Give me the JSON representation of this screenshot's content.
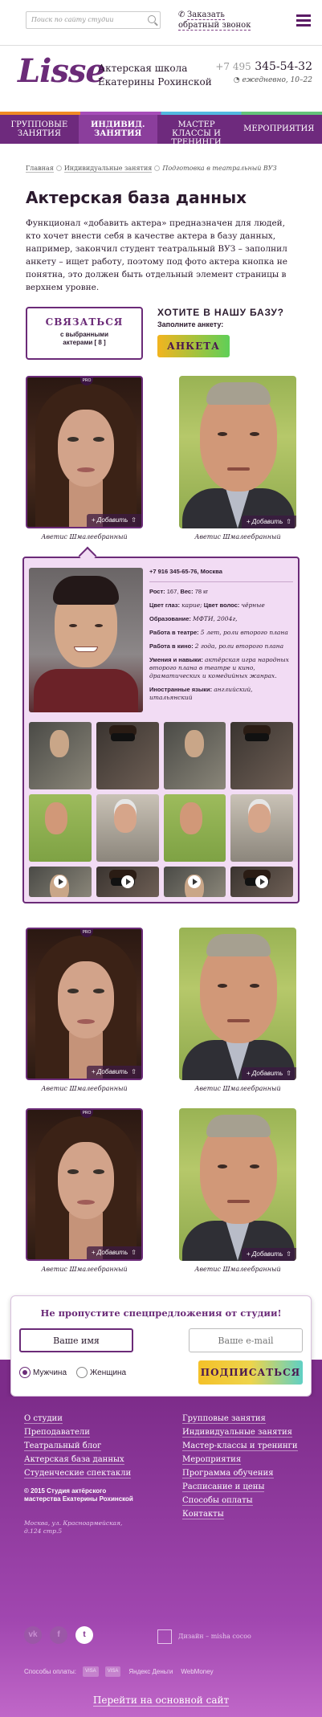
{
  "header": {
    "search_placeholder": "Поиск по сайту студии",
    "callback_line1": "Заказать",
    "callback_line2": "обратный звонок"
  },
  "brand": {
    "logo": "Lisse",
    "school_line1": "Актерская школа",
    "school_line2": "Екатерины Рохинской",
    "phone_prefix": "+7 495",
    "phone_number": "345-54-32",
    "hours": "ежедневно, 10–22"
  },
  "nav": {
    "items": [
      {
        "label": "Групповые занятия"
      },
      {
        "label": "Индивид. занятия"
      },
      {
        "label": "Мастер классы и тренинги"
      },
      {
        "label": "Мероприятия"
      }
    ]
  },
  "breadcrumbs": [
    "Главная",
    "Индивидуальные занятия",
    "Подготовка в театральный ВУЗ"
  ],
  "page": {
    "title": "Актерская база данных",
    "intro": "Функционал «добавить актера» предназначен для людей, кто хочет внести себя в качестве актера в базу данных, например, закончил студент театральный ВУЗ – заполнил анкету – ищет работу, поэтому под фото актера кнопка не понятна, это должен быть отдельный элемент страницы в верхнем уровне."
  },
  "contact_box": {
    "title": "СВЯЗАТЬСЯ",
    "sub1": "с выбранными",
    "sub2": "актерами [ 8 ]"
  },
  "join": {
    "question": "ХОТИТЕ В НАШУ БАЗУ?",
    "sub": "Заполните анкету:",
    "button": "АНКЕТА"
  },
  "card": {
    "pro": "PRO",
    "add_label": "+ Добавить",
    "name": "Аветис Шмалеебранный"
  },
  "profile": {
    "phone_city": "+7 916 345-65-76, Москва",
    "height_label": "Рост:",
    "height_value": "167,",
    "weight_label": "Вес:",
    "weight_value": "78 кг",
    "eyes_label": "Цвет глаз:",
    "eyes_value": "карие;",
    "hair_label": "Цвет волос:",
    "hair_value": "чёрные",
    "edu_label": "Образование:",
    "edu_value": "МФТИ, 2004г,",
    "theatre_label": "Работа в театре:",
    "theatre_value": "5 лет, роли второго плана",
    "cinema_label": "Работа в кино:",
    "cinema_value": "2 года, роли второго плана",
    "skills_label": "Умения и навыки:",
    "skills_value": "актёрская игра народных второго плана в театре и кино, драматических и комедийных жанрах.",
    "lang_label": "Иностранные языки:",
    "lang_value": "английский, итальянский"
  },
  "subscribe": {
    "title": "Не пропустите спецпредложения от студии!",
    "name_value": "Ваше имя",
    "email_placeholder": "Ваше e-mail",
    "male": "Мужчина",
    "female": "Женщина",
    "button": "ПОДПИСАТЬСЯ"
  },
  "footer": {
    "left_links": [
      "О студии",
      "Преподаватели",
      "Театральный блог",
      "Актерская база данных",
      "Студенческие спектакли"
    ],
    "right_links": [
      "Групповые занятия",
      "Индивидуальные занятия",
      "Мастер-классы и тренинги",
      "Мероприятия",
      "Программа обучения",
      "Расписание и цены",
      "Способы оплаты",
      "Контакты"
    ],
    "copyright_line1": "© 2015 Студия актёрского",
    "copyright_line2": "мастерства Екатерины Рохинской",
    "address_line1": "Москва, ул. Красноармейская,",
    "address_line2": "д.124 стр.5",
    "design": "Дизайн – misha cocoo",
    "payments_label": "Способы оплаты:",
    "payments": [
      "VISA",
      "VISA",
      "Яндекс Деньги",
      "WebMoney"
    ],
    "go_main": "Перейти на основной сайт"
  }
}
